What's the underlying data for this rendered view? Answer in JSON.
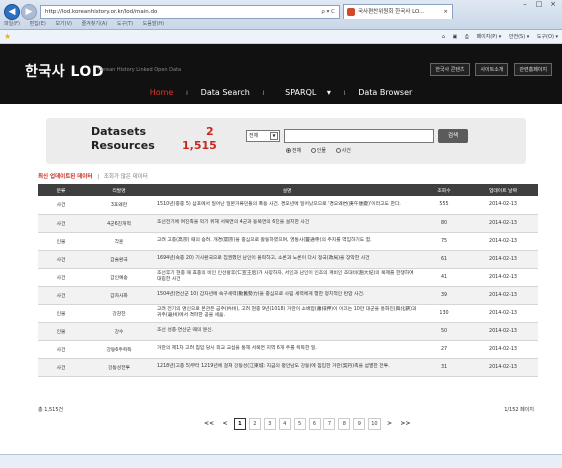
{
  "browser": {
    "address": "http://lod.koreanhistory.or.kr/lod/main.do",
    "address_icons": "ρ ▾ C",
    "tab_title": "국사편찬위원회 한국사 LO...",
    "tab_close": "×",
    "menu": [
      "파일(F)",
      "편집(E)",
      "보기(V)",
      "즐겨찾기(A)",
      "도구(T)",
      "도움말(H)"
    ],
    "toolbar": [
      "페이지(P) ▾",
      "안전(S) ▾",
      "도구(O) ▾"
    ]
  },
  "header": {
    "logo": "한국사 LOD",
    "logo_sub": "Korean History Linked Open Data",
    "links": [
      "한국사 콘텐츠",
      "사이트소개",
      "관련홈페이지"
    ],
    "nav": {
      "home": "Home",
      "data_search": "Data Search",
      "sparql": "SPARQL",
      "data_browser": "Data Browser"
    }
  },
  "stats": {
    "datasets_label": "Datasets",
    "datasets_count": "2",
    "resources_label": "Resources",
    "resources_count": "1,515"
  },
  "search": {
    "select_value": "전체",
    "button_label": "검색",
    "radio_all": "전체",
    "radio_person": "인물",
    "radio_event": "사건"
  },
  "recent": {
    "title": "최신 업데이트된 데이터",
    "subtitle": "조회가 많은 데이터"
  },
  "table": {
    "headers": [
      "분류",
      "리발명",
      "설명",
      "조회수",
      "업데이트 날짜"
    ],
    "rows": [
      {
        "cat": "사건",
        "name": "3포왜란",
        "desc": "1510년(중종 5) 삼포에서 일어난 일본거류민들의 폭동 사건. 경오년에 일어났으므로 '경오왜변(庚午倭變)'이라고도 한다.",
        "views": "555",
        "date": "2014-02-13"
      },
      {
        "cat": "사건",
        "name": "4군6진개척",
        "desc": "조선전기에 여진족을 막기 위해 서북면의 4군과 동북면의 6진을 설치한 사건",
        "views": "80",
        "date": "2014-02-13"
      },
      {
        "cat": "인물",
        "name": "각훈",
        "desc": "고려 고종(高宗) 때의 승려. 개경(開京)을 중심으로 활동하였으며, 영통사(靈通寺)의 주지를 역임하기도 함.",
        "views": "75",
        "date": "2014-02-13"
      },
      {
        "cat": "사건",
        "name": "갑술환국",
        "desc": "1694년(숙종 20) 기사환국으로 집권했던 남인이 몰락하고, 소론과 노론이 다시 정국(政局)을 장악한 사건",
        "views": "61",
        "date": "2014-02-13"
      },
      {
        "cat": "사건",
        "name": "갑인예송",
        "desc": "조선후기 현종 때 효종의 비인 인선왕후(仁宣王后)가 사망하자, 서인과 남인이 인조의 계비인 조대비(趙大妃)의 복제를 한쟁하여 대립한 사건",
        "views": "41",
        "date": "2014-02-13"
      },
      {
        "cat": "사건",
        "name": "갑자사화",
        "desc": "1504년(연산군 10) 갑자년에 숙구세력(勳舊勢力)을 중심으로 사림 세력에게 행한 정치적인 탄압 사건.",
        "views": "39",
        "date": "2014-02-13"
      },
      {
        "cat": "인물",
        "name": "강감찬",
        "desc": "고려 전기의 명신으로 본관은 금주(衿州), 고려 현종 9년(1018) 거란이 소배압(蕭排押)이 이끄는 10만 대군을 흥화진(興化鎭)과 귀주(龜州)에서 격파한 공을 세움.",
        "views": "130",
        "date": "2014-02-13"
      },
      {
        "cat": "인물",
        "name": "강수",
        "desc": "조선 성종·연산군 때의 문신.",
        "views": "50",
        "date": "2014-02-13"
      },
      {
        "cat": "사건",
        "name": "강동6주획득",
        "desc": "거란의 제1차 고려 침입 당시 외교 교섭을 통해 서북면 지역 6개 주를 획득한 일.",
        "views": "27",
        "date": "2014-02-13"
      },
      {
        "cat": "사건",
        "name": "강동성전투",
        "desc": "1218년(고종 5)부터 1219년에 걸쳐 강동성(江東城: 지금의 평안남도 강동)에 침입한 거란(契丹)족을 섬멸한 전투.",
        "views": "31",
        "date": "2014-02-13"
      }
    ]
  },
  "footer": {
    "total": "총 1,515건",
    "page_info": "1/152 페이지",
    "pages": [
      "1",
      "2",
      "3",
      "4",
      "5",
      "6",
      "7",
      "8",
      "9",
      "10"
    ],
    "prev": "<<",
    "prev_one": "<",
    "next_one": ">",
    "next": ">>"
  }
}
